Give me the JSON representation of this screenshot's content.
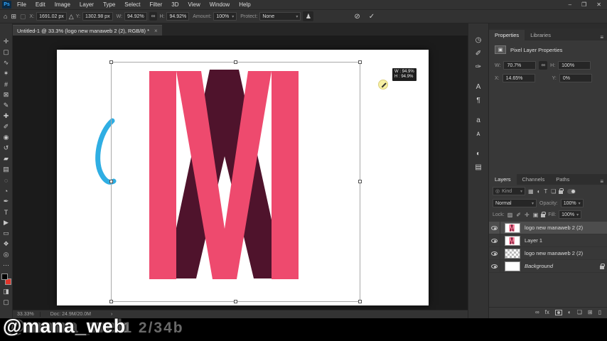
{
  "titlebar": {
    "app_badge": "Ps",
    "menus": [
      "File",
      "Edit",
      "Image",
      "Layer",
      "Type",
      "Select",
      "Filter",
      "3D",
      "View",
      "Window",
      "Help"
    ],
    "window_controls": {
      "minimize": "–",
      "restore": "❐",
      "close": "✕"
    }
  },
  "options_bar": {
    "home_icon": "⌂",
    "reference_point_icon": "⊞",
    "toggle_ref": "▢",
    "x_label": "X:",
    "x_value": "1691.02 px",
    "delta_icon": "△",
    "y_label": "Y:",
    "y_value": "1302.98 px",
    "w_label": "W:",
    "w_value": "94.92%",
    "link_icon": "∞",
    "h_label": "H:",
    "h_value": "94.92%",
    "amount_label": "Amount:",
    "amount_value": "100%",
    "protect_label": "Protect:",
    "protect_value": "None",
    "person_icon": "♟",
    "cancel_icon": "⊘",
    "commit_icon": "✓",
    "caret": "▾"
  },
  "document_tab": {
    "title": "Untitled-1 @ 33.3% (logo new manaweb 2 (2), RGB/8) *",
    "close": "×"
  },
  "tools": [
    {
      "name": "move-tool",
      "glyph": "✛"
    },
    {
      "name": "rectangular-marquee-tool",
      "glyph": "▢"
    },
    {
      "name": "lasso-tool",
      "glyph": "∿"
    },
    {
      "name": "quick-selection-tool",
      "glyph": "✶"
    },
    {
      "name": "crop-tool",
      "glyph": "#"
    },
    {
      "name": "frame-tool",
      "glyph": "⊠"
    },
    {
      "name": "eyedropper-tool",
      "glyph": "✎"
    },
    {
      "name": "healing-brush-tool",
      "glyph": "✚"
    },
    {
      "name": "brush-tool",
      "glyph": "✐"
    },
    {
      "name": "clone-stamp-tool",
      "glyph": "◉"
    },
    {
      "name": "history-brush-tool",
      "glyph": "↺"
    },
    {
      "name": "eraser-tool",
      "glyph": "▰"
    },
    {
      "name": "gradient-tool",
      "glyph": "▤"
    },
    {
      "name": "blur-tool",
      "glyph": "◌"
    },
    {
      "name": "dodge-tool",
      "glyph": "◔"
    },
    {
      "name": "pen-tool",
      "glyph": "✒"
    },
    {
      "name": "type-tool",
      "glyph": "T"
    },
    {
      "name": "path-selection-tool",
      "glyph": "▶"
    },
    {
      "name": "shape-tool",
      "glyph": "▭"
    },
    {
      "name": "hand-tool",
      "glyph": "❖"
    },
    {
      "name": "zoom-tool",
      "glyph": "◎"
    },
    {
      "name": "edit-toolbar",
      "glyph": "⋯"
    }
  ],
  "tool_colors": {
    "foreground": "#000000",
    "background": "#e0352b"
  },
  "extra_tools": [
    {
      "name": "quick-mask-icon",
      "glyph": "◨"
    },
    {
      "name": "screen-mode-icon",
      "glyph": "▢"
    }
  ],
  "dock_icons": [
    {
      "name": "history-panel-icon",
      "glyph": "◷"
    },
    {
      "name": "brush-settings-panel-icon",
      "glyph": "✐"
    },
    {
      "name": "tool-presets-panel-icon",
      "glyph": "✑"
    },
    {
      "name": "character-panel-icon",
      "glyph": "A"
    },
    {
      "name": "paragraph-panel-icon",
      "glyph": "¶"
    },
    {
      "name": "glyphs-panel-icon",
      "glyph": "a"
    },
    {
      "name": "character-styles-panel-icon",
      "glyph": "ᴀ"
    },
    {
      "name": "adjustments-panel-icon",
      "glyph": "◐"
    },
    {
      "name": "info-panel-icon",
      "glyph": "▤"
    }
  ],
  "canvas": {
    "hud_w": "W : 94.9%",
    "hud_h": "H : 94.9%",
    "logo_colors": {
      "pink": "#ee4a6e",
      "maroon": "#4f132c",
      "stroke_blue": "#2faee3"
    }
  },
  "properties_panel": {
    "tabs": [
      "Properties",
      "Libraries"
    ],
    "menu_icon": "≡",
    "title": "Pixel Layer Properties",
    "thumb_icon": "▣",
    "w_label": "W:",
    "w_value": "70.7%",
    "link_icon": "∞",
    "h_label": "H:",
    "h_value": "100%",
    "x_label": "X:",
    "x_value": "14.65%",
    "y_label": "Y:",
    "y_value": "0%"
  },
  "layers_panel": {
    "tabs": [
      "Layers",
      "Channels",
      "Paths"
    ],
    "menu_icon": "≡",
    "search_icon": "◎",
    "filter_value": "Kind",
    "filter_caret": "▾",
    "filter_icons": [
      {
        "name": "filter-pixel-layers-icon",
        "glyph": "▦"
      },
      {
        "name": "filter-adjustment-layers-icon",
        "glyph": "◐"
      },
      {
        "name": "filter-type-layers-icon",
        "glyph": "T"
      },
      {
        "name": "filter-shape-layers-icon",
        "glyph": "❏"
      }
    ],
    "blend_mode": "Normal",
    "blend_caret": "▾",
    "opacity_label": "Opacity:",
    "opacity_value": "100%",
    "lock_label": "Lock:",
    "lock_icons": [
      {
        "name": "lock-transparent-icon",
        "glyph": "▨"
      },
      {
        "name": "lock-pixels-icon",
        "glyph": "✐"
      },
      {
        "name": "lock-position-icon",
        "glyph": "✛"
      },
      {
        "name": "lock-artboard-icon",
        "glyph": "▣"
      }
    ],
    "fill_label": "Fill:",
    "fill_value": "100%",
    "caret": "▾",
    "layers": [
      {
        "name": "logo new manaweb 2 (2)",
        "thumb": "logo",
        "selected": true,
        "italic": false,
        "locked": false
      },
      {
        "name": "Layer 1",
        "thumb": "logo",
        "selected": false,
        "italic": false,
        "locked": false
      },
      {
        "name": "logo new manaweb 2 (2)",
        "thumb": "transparent",
        "selected": false,
        "italic": false,
        "locked": false
      },
      {
        "name": "Background",
        "thumb": "white",
        "selected": false,
        "italic": true,
        "locked": true
      }
    ],
    "bottom_icons": [
      {
        "name": "link-layers-icon",
        "glyph": "∞"
      },
      {
        "name": "layer-effects-icon",
        "glyph": "fx"
      },
      {
        "name": "layer-mask-icon",
        "glyph": ""
      },
      {
        "name": "adjustment-layer-icon",
        "glyph": "◐"
      },
      {
        "name": "layer-group-icon",
        "glyph": "❏"
      },
      {
        "name": "new-layer-icon",
        "glyph": "⊞"
      },
      {
        "name": "delete-layer-icon",
        "glyph": "▯"
      }
    ]
  },
  "status_bar": {
    "zoom": "33.33%",
    "doc": "Doc: 24.9M/20.0M",
    "chevron": "›"
  },
  "watermark": {
    "primary": "@mana_web",
    "ghost_tail": "1 2/34b"
  }
}
